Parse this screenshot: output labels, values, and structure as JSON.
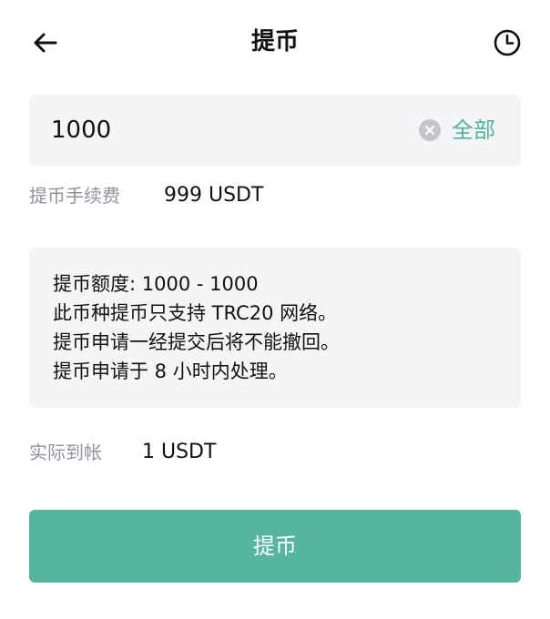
{
  "header": {
    "title": "提币",
    "back_icon": "arrow-left-icon",
    "history_icon": "clock-icon"
  },
  "amount": {
    "value": "1000",
    "clear_icon": "clear-icon",
    "all_label": "全部"
  },
  "fee": {
    "label": "提币手续费",
    "value": "999 USDT"
  },
  "info": {
    "lines": [
      "提币额度: 1000 - 1000",
      "此币种提币只支持 TRC20 网络。",
      "提币申请一经提交后将不能撤回。",
      "提币申请于 8 小时内处理。"
    ]
  },
  "actual": {
    "label": "实际到帐",
    "value": "1 USDT"
  },
  "submit": {
    "label": "提币"
  },
  "colors": {
    "accent": "#55b5a0",
    "accent_text": "#4db49c",
    "panel": "#f5f5f7",
    "muted_text": "#8f939c"
  }
}
